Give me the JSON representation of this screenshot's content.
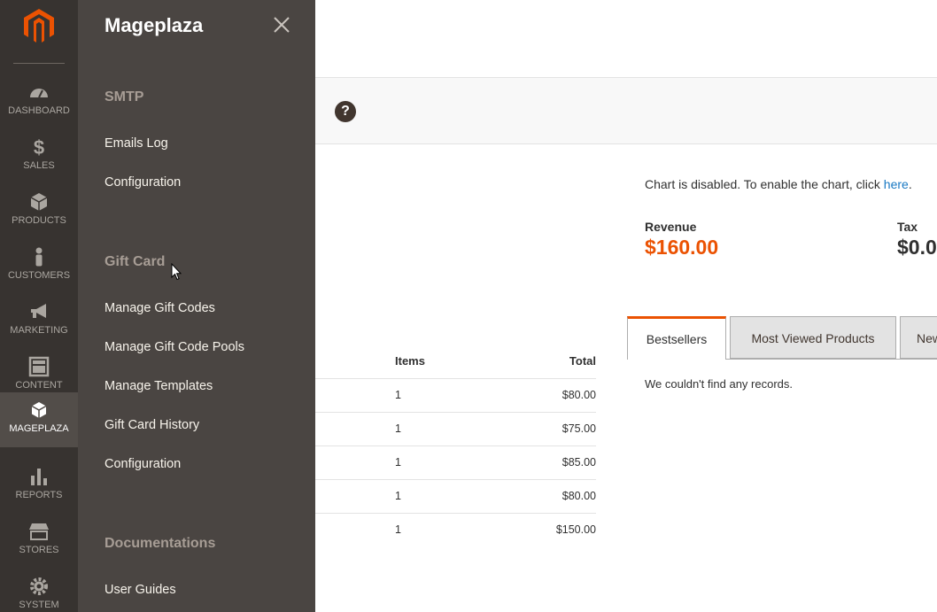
{
  "nav": {
    "items": [
      {
        "label": "DASHBOARD",
        "icon": "dashboard-icon"
      },
      {
        "label": "SALES",
        "icon": "dollar-icon"
      },
      {
        "label": "PRODUCTS",
        "icon": "box-icon"
      },
      {
        "label": "CUSTOMERS",
        "icon": "person-icon"
      },
      {
        "label": "MARKETING",
        "icon": "megaphone-icon"
      },
      {
        "label": "CONTENT",
        "icon": "layout-icon"
      },
      {
        "label": "MAGEPLAZA",
        "icon": "cube-icon"
      },
      {
        "label": "REPORTS",
        "icon": "bar-chart-icon"
      },
      {
        "label": "STORES",
        "icon": "store-icon"
      },
      {
        "label": "SYSTEM",
        "icon": "gear-icon"
      }
    ],
    "active": "MAGEPLAZA",
    "colors": {
      "bg": "#373330",
      "active_bg": "#524d49",
      "logo": "#eb5202"
    }
  },
  "flyout": {
    "title": "Mageplaza",
    "sections": [
      {
        "title": "SMTP",
        "links": [
          "Emails Log",
          "Configuration"
        ]
      },
      {
        "title": "Gift Card",
        "links": [
          "Manage Gift Codes",
          "Manage Gift Code Pools",
          "Manage Templates",
          "Gift Card History",
          "Configuration"
        ]
      },
      {
        "title": "Documentations",
        "links": [
          "User Guides"
        ]
      }
    ]
  },
  "dashboard": {
    "help_glyph": "?",
    "chart_message": "Chart is disabled. To enable the chart, click ",
    "chart_link": "here",
    "chart_suffix": ".",
    "revenue_label": "Revenue",
    "revenue_value": "$160.00",
    "tax_label": "Tax",
    "tax_value": "$0.0",
    "tabs": [
      "Bestsellers",
      "Most Viewed Products",
      "New"
    ],
    "no_records": "We couldn't find any records.",
    "orders": {
      "headers": [
        "Items",
        "Total"
      ],
      "rows": [
        {
          "items": "1",
          "total": "$80.00"
        },
        {
          "items": "1",
          "total": "$75.00"
        },
        {
          "items": "1",
          "total": "$85.00"
        },
        {
          "items": "1",
          "total": "$80.00"
        },
        {
          "items": "1",
          "total": "$150.00"
        }
      ]
    },
    "colors": {
      "accent": "#eb5202",
      "link": "#1979c3"
    }
  }
}
